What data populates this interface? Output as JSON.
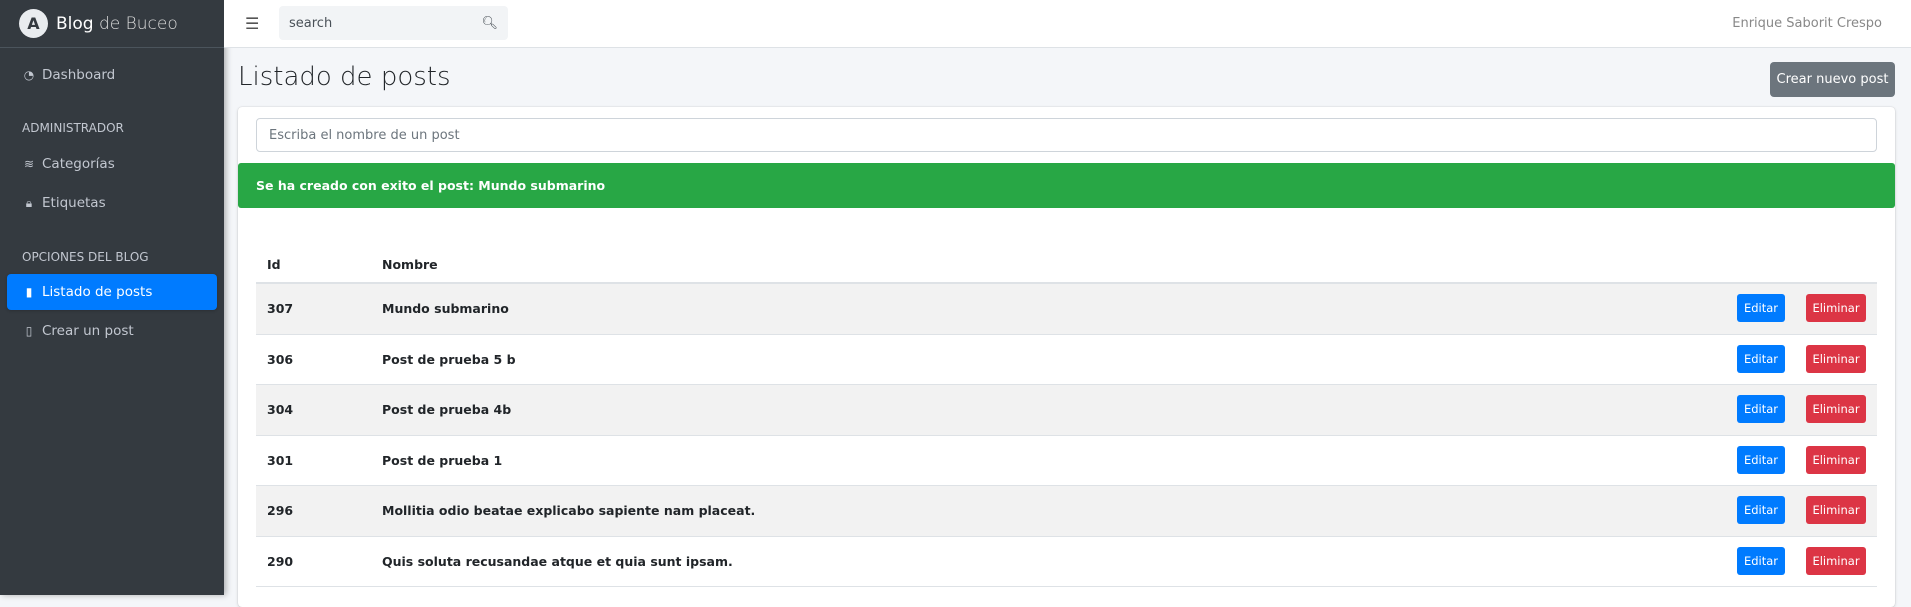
{
  "brand": {
    "name_bold": "Blog",
    "name_light": "de Buceo"
  },
  "sidebar": {
    "dashboard": "Dashboard",
    "admin_header": "ADMINISTRADOR",
    "categorias": "Categorías",
    "etiquetas": "Etiquetas",
    "blog_header": "OPCIONES DEL BLOG",
    "listado": "Listado de posts",
    "crear": "Crear un post"
  },
  "topbar": {
    "search_placeholder": "search",
    "user": "Enrique Saborit Crespo"
  },
  "page": {
    "title": "Listado de posts",
    "new_button": "Crear nuevo post",
    "filter_placeholder": "Escriba el nombre de un post",
    "alert": "Se ha creado con exito el post: Mundo submarino"
  },
  "table": {
    "headers": [
      "Id",
      "Nombre"
    ],
    "edit_label": "Editar",
    "delete_label": "Eliminar",
    "rows": [
      {
        "id": "307",
        "name": "Mundo submarino"
      },
      {
        "id": "306",
        "name": "Post de prueba 5 b"
      },
      {
        "id": "304",
        "name": "Post de prueba 4b"
      },
      {
        "id": "301",
        "name": "Post de prueba 1"
      },
      {
        "id": "296",
        "name": "Mollitia odio beatae explicabo sapiente nam placeat."
      },
      {
        "id": "290",
        "name": "Quis soluta recusandae atque et quia sunt ipsam."
      }
    ]
  }
}
